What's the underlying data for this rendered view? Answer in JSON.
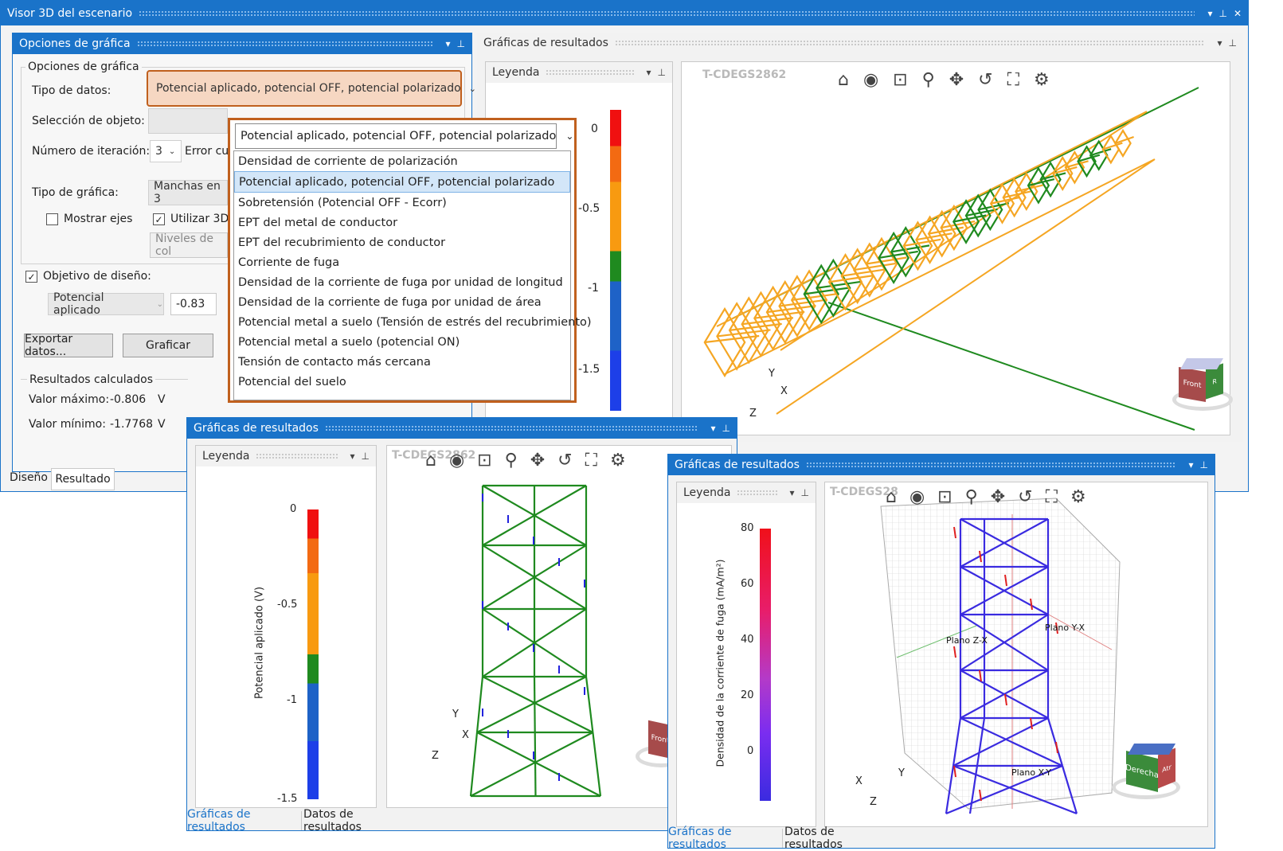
{
  "main_window": {
    "title": "Visor 3D del escenario"
  },
  "options_panel": {
    "title": "Opciones de gráfica",
    "group_title": "Opciones de gráfica",
    "tipo_datos_label": "Tipo de datos:",
    "tipo_datos_value": "Potencial aplicado, potencial OFF, potencial polarizado",
    "seleccion_objeto_label": "Selección de objeto:",
    "numero_iteracion_label": "Número de iteración:",
    "numero_iteracion_value": "3",
    "error_label": "Error cu",
    "tipo_grafica_label": "Tipo de gráfica:",
    "tipo_grafica_value": "Manchas en 3",
    "mostrar_ejes_label": "Mostrar ejes",
    "mostrar_ejes_checked": false,
    "utilizar_3d_label": "Utilizar 3D",
    "utilizar_3d_checked": true,
    "niveles_placeholder": "Niveles de col",
    "objetivo_label": "Objetivo de diseño:",
    "objetivo_checked": true,
    "objetivo_tipo": "Potencial aplicado",
    "objetivo_valor": "-0.83",
    "exportar_label": "Exportar datos...",
    "graficar_label": "Graficar",
    "resultados_title": "Resultados calculados",
    "valor_maximo_label": "Valor máximo:",
    "valor_maximo": "-0.806",
    "valor_maximo_unit": "V",
    "valor_minimo_label": "Valor mínimo:",
    "valor_minimo": "-1.7768",
    "valor_minimo_unit": "V",
    "tabs": [
      "Diseño",
      "Resultado"
    ]
  },
  "dropdown": {
    "selected": "Potencial aplicado, potencial OFF, potencial polarizado",
    "options": [
      "Densidad de corriente de polarización",
      "Potencial aplicado, potencial OFF, potencial polarizado",
      "Sobretensión (Potencial OFF - Ecorr)",
      "EPT del metal de conductor",
      "EPT del recubrimiento de conductor",
      "Corriente de fuga",
      "Densidad de la corriente de fuga por unidad de longitud",
      "Densidad de la corriente de fuga por unidad de área",
      "Potencial metal a suelo (Tensión de estrés del recubrimiento)",
      "Potencial metal a suelo (potencial ON)",
      "Tensión de contacto más cercana",
      "Potencial del suelo"
    ],
    "selected_index": 1
  },
  "graph_main": {
    "title": "Gráficas de resultados",
    "legend_title": "Leyenda",
    "watermark": "T-CDEGS2862",
    "scale_ticks": [
      "0",
      "-0.5",
      "-1",
      "-1.5"
    ],
    "axis_labels": {
      "x": "X",
      "y": "Y",
      "z": "Z"
    },
    "cube_faces": {
      "front": "Front",
      "side": "R"
    }
  },
  "graph_second": {
    "title": "Gráficas de resultados",
    "legend_title": "Leyenda",
    "watermark": "T-CDEGS2862",
    "scale_title": "Potencial aplicado (V)",
    "scale_ticks": [
      "0",
      "-0.5",
      "-1",
      "-1.5"
    ],
    "axis_labels": {
      "x": "X",
      "y": "Y",
      "z": "Z"
    },
    "cube_faces": {
      "front": "Front"
    },
    "tabs": [
      "Gráficas de resultados",
      "Datos de resultados"
    ]
  },
  "graph_third": {
    "title": "Gráficas de resultados",
    "legend_title": "Leyenda",
    "watermark": "T-CDEGS28",
    "scale_title": "Densidad de la corriente de fuga (mA/m²)",
    "scale_ticks": [
      "80",
      "60",
      "40",
      "20",
      "0"
    ],
    "plane_labels": [
      "Plano Y-X",
      "Plano Z-X",
      "Plano X-Y"
    ],
    "axis_labels": {
      "x": "X",
      "y": "Y",
      "z": "Z"
    },
    "cube_faces": {
      "front": "Derecha",
      "side": "Atr"
    },
    "tabs": [
      "Gráficas de resultados",
      "Datos de resultados"
    ]
  },
  "toolbar_icons": [
    "home-icon",
    "eye-icon",
    "zoom-box-icon",
    "zoom-icon",
    "pan-icon",
    "rotate-icon",
    "fit-icon",
    "settings-icon"
  ],
  "colors": {
    "accent": "#1a73c9",
    "dropdown_border": "#c0601e",
    "structure_orange": "#f5a623",
    "structure_green": "#1f8a1f",
    "structure_blue": "#3a2be0"
  }
}
